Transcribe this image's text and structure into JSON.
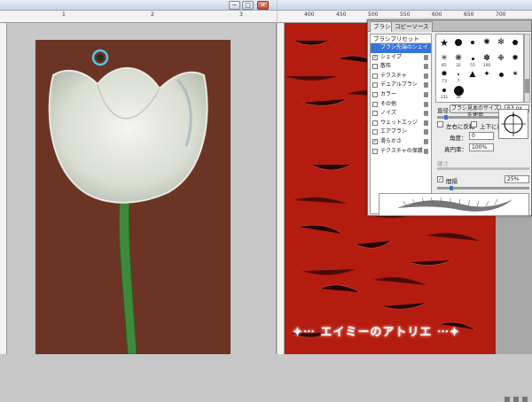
{
  "window_controls": {
    "minimize": "─",
    "maximize": "□",
    "close": "✕"
  },
  "left_ruler": {
    "labels": [
      "1",
      "2",
      "3"
    ]
  },
  "right_ruler": {
    "labels": [
      "400",
      "450",
      "500",
      "550",
      "600",
      "650",
      "700"
    ]
  },
  "panel": {
    "tabs": [
      "ブラシ",
      "コピーソース"
    ],
    "list": [
      {
        "label": "ブラシ先端のシェイプ",
        "checked": false,
        "selected": true
      },
      {
        "label": "シェイプ",
        "checked": true,
        "selected": false
      },
      {
        "label": "散布",
        "checked": false,
        "selected": false
      },
      {
        "label": "テクスチャ",
        "checked": false,
        "selected": false
      },
      {
        "label": "デュアルブラシ",
        "checked": false,
        "selected": false
      },
      {
        "label": "カラー",
        "checked": false,
        "selected": false
      },
      {
        "label": "その他",
        "checked": false,
        "selected": false
      },
      {
        "label": "ノイズ",
        "checked": false,
        "selected": false
      },
      {
        "label": "ウェットエッジ",
        "checked": false,
        "selected": false
      },
      {
        "label": "エアブラシ",
        "checked": false,
        "selected": false
      },
      {
        "label": "滑らかさ",
        "checked": true,
        "selected": false
      },
      {
        "label": "テクスチャの保護",
        "checked": false,
        "selected": false
      }
    ],
    "list_header": "ブラシプリセット",
    "tip_numbers": [
      "65",
      "32",
      "55",
      "100",
      "73",
      "7",
      "131",
      "36"
    ],
    "size_label": "直径",
    "size_button": "ブラシ見本のサイズを使用",
    "size_value": "63 px",
    "flip_x_label": "左右に反転",
    "flip_y_label": "上下に反転",
    "angle_label": "角度：",
    "angle_value": "0",
    "roundness_label": "真円率：",
    "roundness_value": "100%",
    "hardness_label": "硬さ",
    "spacing_label": "間隔",
    "spacing_value": "25%"
  },
  "watermark": "✦⋯ エイミーのアトリエ ⋯✦",
  "colors": {
    "left_canvas": "#6b3424",
    "right_canvas": "#b51c10",
    "selection": "#3874d8"
  }
}
